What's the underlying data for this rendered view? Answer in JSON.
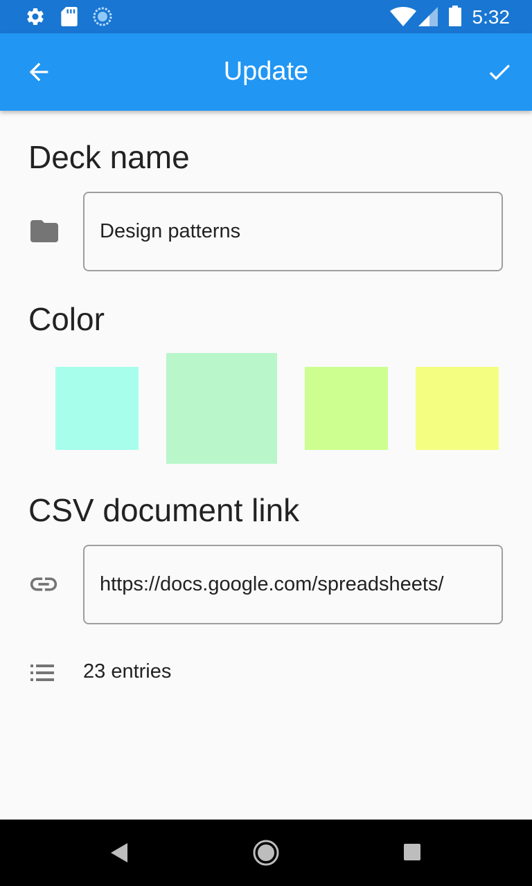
{
  "status_bar": {
    "time": "5:32",
    "icons": [
      "settings-icon",
      "sd-card-icon",
      "sync-icon",
      "wifi-icon",
      "signal-icon",
      "battery-icon"
    ]
  },
  "app_bar": {
    "title": "Update",
    "back_icon": "arrow-back-icon",
    "confirm_icon": "check-icon",
    "color": "#2196f3"
  },
  "deck_name": {
    "section_title": "Deck name",
    "icon": "folder-icon",
    "value": "Design patterns"
  },
  "color": {
    "section_title": "Color",
    "swatches": [
      {
        "color": "#a7ffeb",
        "selected": false
      },
      {
        "color": "#b9f6ca",
        "selected": true
      },
      {
        "color": "#ccff90",
        "selected": false
      },
      {
        "color": "#f4ff81",
        "selected": false
      }
    ]
  },
  "csv_link": {
    "section_title": "CSV document link",
    "icon": "link-icon",
    "value": "https://docs.google.com/spreadsheets/"
  },
  "entries": {
    "icon": "list-icon",
    "text": "23 entries"
  },
  "nav_bar": {
    "buttons": [
      "back-triangle-icon",
      "home-circle-icon",
      "recents-square-icon"
    ]
  }
}
